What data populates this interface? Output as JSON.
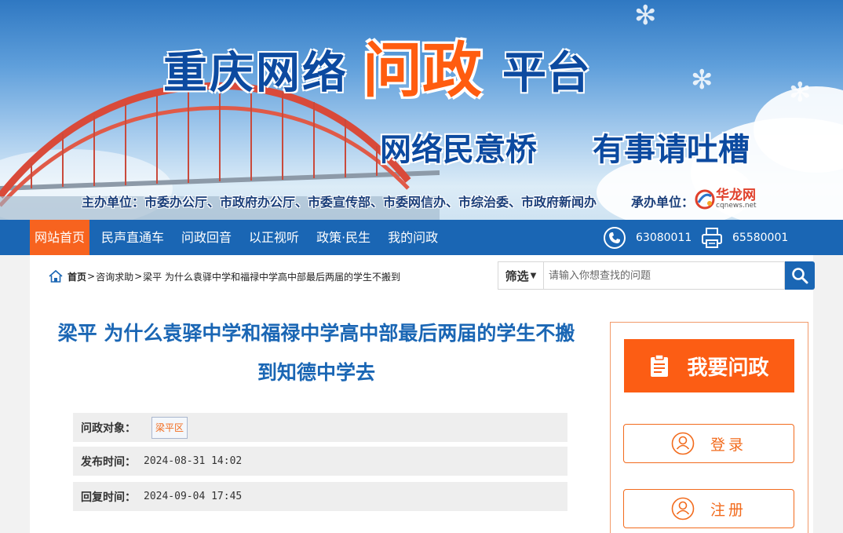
{
  "banner": {
    "title_part1": "重庆网络",
    "title_accent": "问政",
    "title_part2": "平台",
    "slogan1": "网络民意桥",
    "slogan2": "有事请吐槽",
    "sponsors": "主办单位：市委办公厅、市政府办公厅、市委宣传部、市委网信办、市综治委、市政府新闻办",
    "undertaker_label": "承办单位：",
    "undertaker_name": "华龙网",
    "undertaker_domain": "cqnews.net"
  },
  "nav": {
    "items": [
      {
        "label": "网站首页",
        "active": true
      },
      {
        "label": "民声直通车",
        "active": false
      },
      {
        "label": "问政回音",
        "active": false
      },
      {
        "label": "以正视听",
        "active": false
      },
      {
        "label": "政策·民生",
        "active": false
      },
      {
        "label": "我的问政",
        "active": false
      }
    ],
    "phone": "63080011",
    "fax": "65580001"
  },
  "breadcrumb": {
    "home": "首页",
    "category": "咨询求助",
    "current": "梁平  为什么袁驿中学和福禄中学高中部最后两届的学生不搬到"
  },
  "search": {
    "filter_label": "筛选",
    "placeholder": "请输入你想查找的问题"
  },
  "question": {
    "title": "梁平 为什么袁驿中学和福禄中学高中部最后两届的学生不搬到知德中学去",
    "target_label": "问政对象：",
    "target_value": "梁平区",
    "published_label": "发布时间：",
    "published_value": "2024-08-31 14:02",
    "replied_label": "回复时间：",
    "replied_value": "2024-09-04 17:45"
  },
  "sidebar": {
    "ask_label": "我要问政",
    "login_label": "登录",
    "register_label": "注册"
  },
  "colors": {
    "nav_blue": "#1a66b4",
    "accent_orange": "#f7631f",
    "title_blue": "#1a66b4"
  }
}
